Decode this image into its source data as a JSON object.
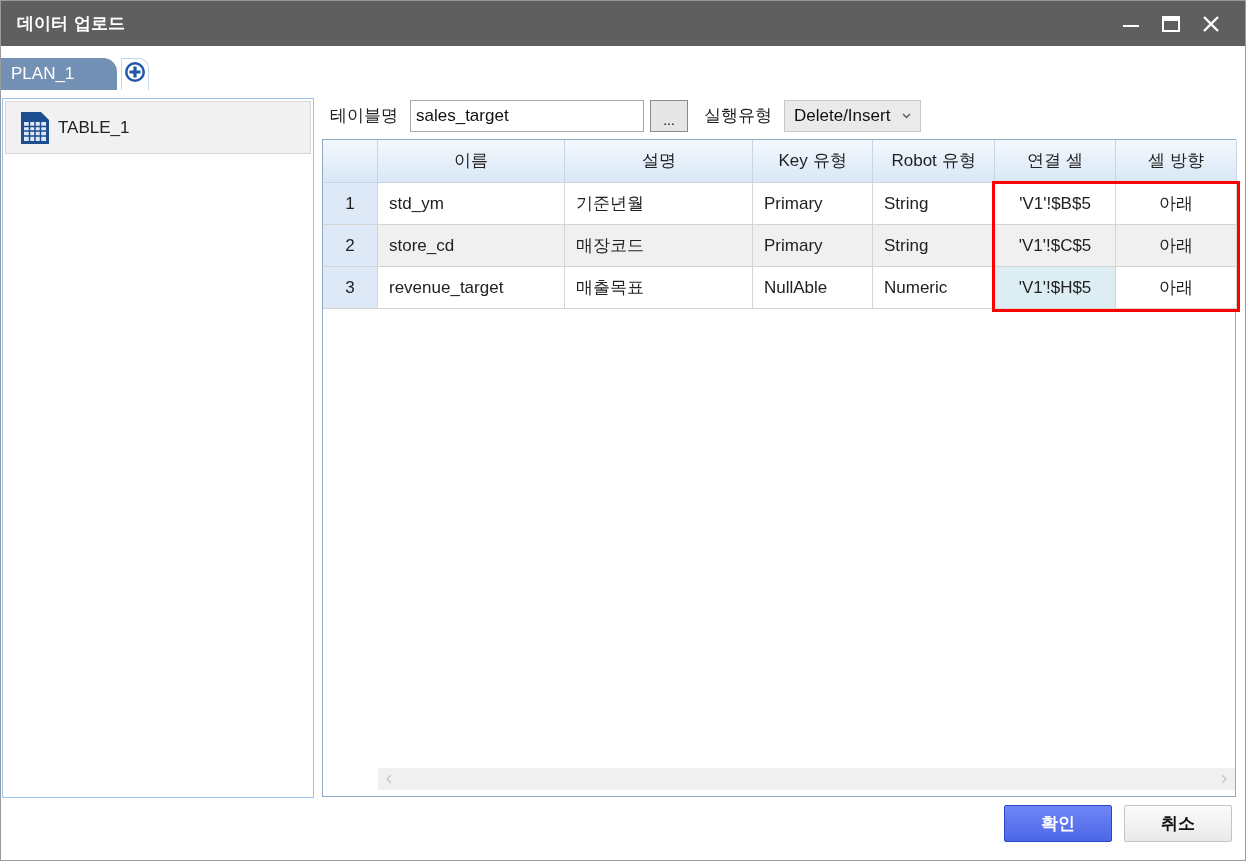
{
  "window": {
    "title": "데이터 업로드"
  },
  "tabs": [
    {
      "label": "PLAN_1",
      "selected": true
    }
  ],
  "sidebar": {
    "items": [
      {
        "label": "TABLE_1",
        "selected": true
      }
    ]
  },
  "toolbar": {
    "table_name_label": "테이블명",
    "table_name": "sales_target",
    "browse_button": "...",
    "run_type_label": "실행유형",
    "run_type": "Delete/Insert"
  },
  "table": {
    "columns": [
      {
        "highlighted": false
      },
      {
        "label": "이름",
        "highlighted": false
      },
      {
        "label": "설명",
        "highlighted": false
      },
      {
        "label": "Key 유형",
        "highlighted": false
      },
      {
        "label": "Robot 유형",
        "highlighted": false
      },
      {
        "label": "연결 셀",
        "highlighted": true
      },
      {
        "label": "셀 방향",
        "highlighted": true
      }
    ],
    "rows": [
      {
        "cells": [
          {
            "text": "1",
            "selected": false
          },
          {
            "text": "std_ym",
            "selected": false
          },
          {
            "text": "기준년월",
            "selected": false
          },
          {
            "text": "Primary",
            "selected": false
          },
          {
            "text": "String",
            "selected": false
          },
          {
            "text": "'V1'!$B$5",
            "selected": false
          },
          {
            "text": "아래",
            "selected": false
          }
        ]
      },
      {
        "cells": [
          {
            "text": "2",
            "selected": false
          },
          {
            "text": "store_cd",
            "selected": false
          },
          {
            "text": "매장코드",
            "selected": false
          },
          {
            "text": "Primary",
            "selected": false
          },
          {
            "text": "String",
            "selected": false
          },
          {
            "text": "'V1'!$C$5",
            "selected": false
          },
          {
            "text": "아래",
            "selected": false
          }
        ]
      },
      {
        "cells": [
          {
            "text": "3",
            "selected": false
          },
          {
            "text": "revenue_target",
            "selected": false
          },
          {
            "text": "매출목표",
            "selected": false
          },
          {
            "text": "NullAble",
            "selected": false
          },
          {
            "text": "Numeric",
            "selected": false
          },
          {
            "text": "'V1'!$H$5",
            "selected": true
          },
          {
            "text": "아래",
            "selected": false
          }
        ]
      }
    ]
  },
  "buttons": [
    {
      "label": "확인",
      "kind": "primary"
    },
    {
      "label": "취소",
      "kind": "secondary"
    }
  ]
}
